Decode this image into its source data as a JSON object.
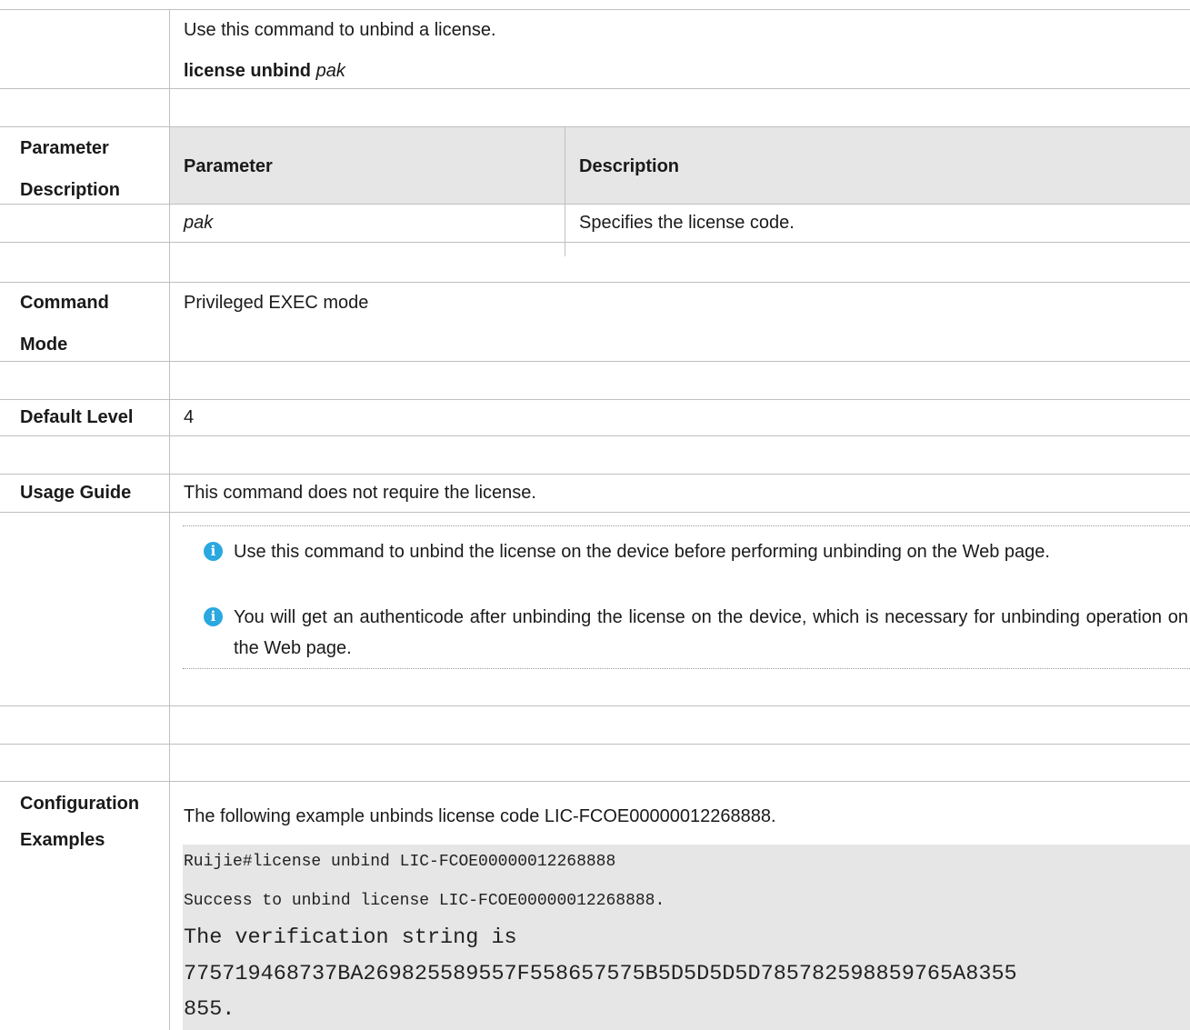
{
  "top": {
    "intro": "Use this command to unbind a license.",
    "syntax_bold": "license unbind",
    "syntax_arg": "pak"
  },
  "parameter_description": {
    "label": "Parameter Description",
    "col_parameter": "Parameter",
    "col_description": "Description",
    "rows": [
      {
        "parameter": "pak",
        "description": "Specifies the license code."
      }
    ]
  },
  "command_mode": {
    "label": "Command Mode",
    "value": "Privileged EXEC mode"
  },
  "default_level": {
    "label": "Default Level",
    "value": "4"
  },
  "usage_guide": {
    "label": "Usage Guide",
    "text": "This command does not require the license.",
    "notes": [
      "Use this command to unbind the license on the device before performing unbinding on the Web page.",
      "You will get an authenticode after unbinding the license on the device, which is necessary for unbinding operation on the Web page."
    ],
    "note_icon": "info-icon",
    "note_icon_color": "#2aa8e0"
  },
  "configuration_examples": {
    "label": "Configuration Examples",
    "text": "The following example unbinds license code LIC-FCOE00000012268888.",
    "code_lines": [
      "Ruijie#license unbind LIC-FCOE00000012268888",
      "Success to unbind license LIC-FCOE00000012268888.",
      "The verification string is",
      "775719468737BA269825589557F558657575B5D5D5D5D785782598859765A8355",
      "855."
    ],
    "code_background": "#e6e6e6"
  }
}
